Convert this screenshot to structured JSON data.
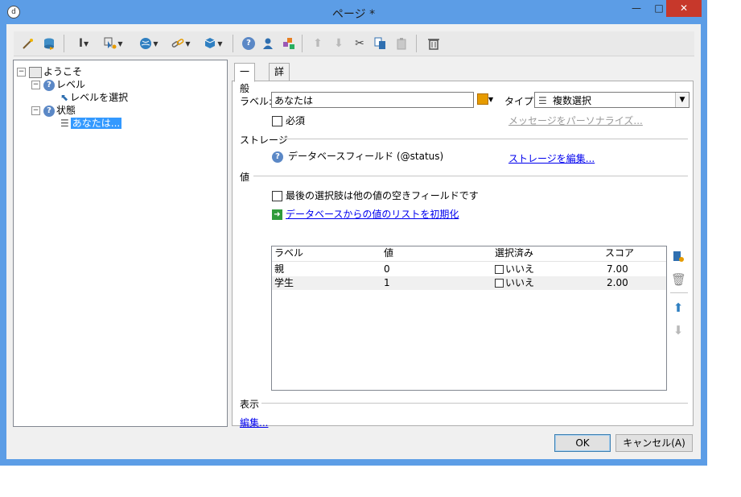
{
  "window": {
    "title": "ページ *",
    "minimize": "—",
    "maximize": "□",
    "close": "✕"
  },
  "toolbar": {
    "icons": [
      "wand-icon",
      "database-icon",
      "text-cursor-icon",
      "cursor-gear-icon",
      "globe-icon",
      "link-icon",
      "cubes-icon",
      "help-icon",
      "user-icon",
      "add-shapes-icon",
      "arrow-up-icon",
      "arrow-down-icon",
      "scissors-icon",
      "copy-icon",
      "paste-icon",
      "delete-icon"
    ]
  },
  "tree": {
    "root": "ようこそ",
    "level": "レベル",
    "level_child": "レベルを選択",
    "status": "状態",
    "status_child": "あなたは..."
  },
  "tabs": [
    "一般",
    "詳細設定"
  ],
  "form": {
    "label_caption": "ラベル:",
    "label_value": "あなたは",
    "type_caption": "タイプ:",
    "type_value": "複数選択",
    "required": "必須",
    "personalize_link": "メッセージをパーソナライズ...",
    "storage_section": "ストレージ",
    "storage_field": "データベースフィールド (@status)",
    "edit_storage_link": "ストレージを編集...",
    "values_section": "値",
    "last_choice_checkbox": "最後の選択肢は他の値の空きフィールドです",
    "init_list_link": "データベースからの値のリストを初期化",
    "display_section": "表示",
    "edit_link": "編集..."
  },
  "grid": {
    "columns": [
      "ラベル",
      "値",
      "選択済み",
      "スコア"
    ],
    "rows": [
      {
        "label": "親",
        "value": "0",
        "selected": "いいえ",
        "score": "7.00"
      },
      {
        "label": "学生",
        "value": "1",
        "selected": "いいえ",
        "score": "2.00"
      }
    ]
  },
  "buttons": {
    "ok": "OK",
    "cancel": "キャンセル(A)"
  }
}
